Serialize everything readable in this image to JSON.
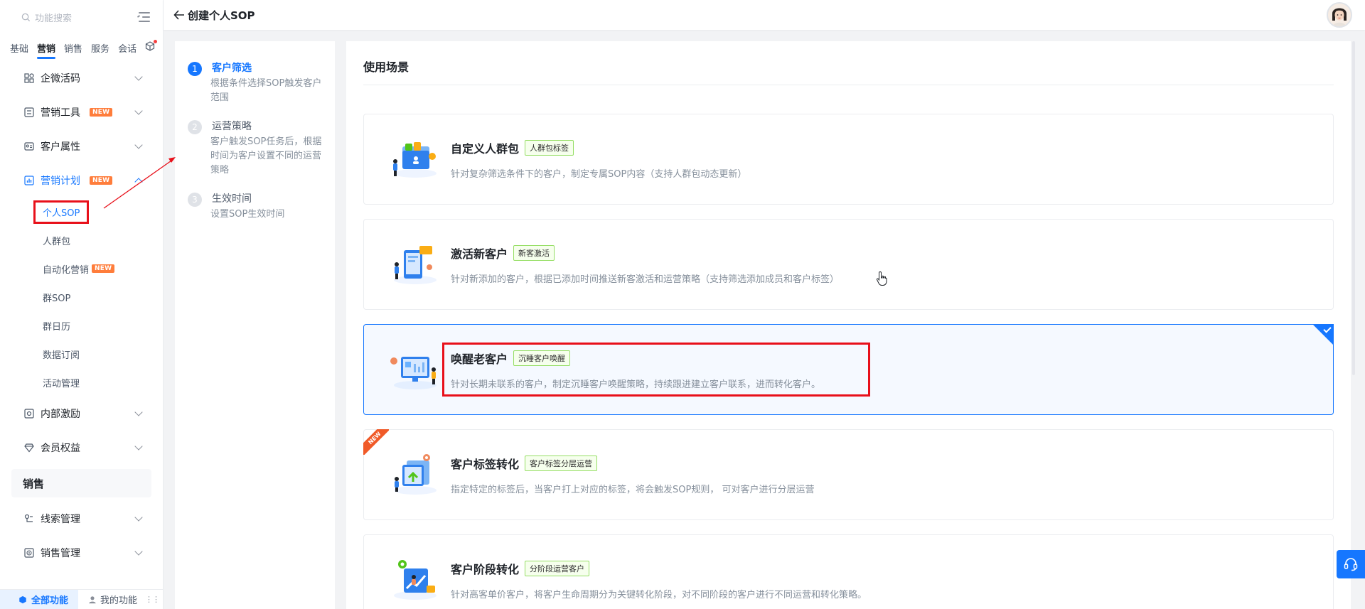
{
  "sidebar": {
    "search_placeholder": "功能搜索",
    "tabs": [
      {
        "label": "基础"
      },
      {
        "label": "营销"
      },
      {
        "label": "销售"
      },
      {
        "label": "服务"
      },
      {
        "label": "会话"
      }
    ],
    "groups": {
      "qw_code": "企微活码",
      "marketing_tools": "营销工具",
      "customer_attr": "客户属性",
      "marketing_plan": "营销计划",
      "internal_incentive": "内部激励",
      "member_benefits": "会员权益",
      "lead_mgmt": "线索管理",
      "sales_mgmt": "销售管理"
    },
    "new_tag": "NEW",
    "sub_items": {
      "personal_sop": "个人SOP",
      "crowd_pack": "人群包",
      "auto_marketing": "自动化营销",
      "group_sop": "群SOP",
      "group_calendar": "群日历",
      "data_subscription": "数据订阅",
      "activity_mgmt": "活动管理"
    },
    "section_sales": "销售",
    "bottom": {
      "all_functions": "全部功能",
      "my_functions": "我的功能"
    }
  },
  "header": {
    "title": "创建个人SOP"
  },
  "steps": [
    {
      "num": "1",
      "title": "客户筛选",
      "desc": "根据条件选择SOP触发客户范围"
    },
    {
      "num": "2",
      "title": "运营策略",
      "desc": "客户触发SOP任务后，根据时间为客户设置不同的运营策略"
    },
    {
      "num": "3",
      "title": "生效时间",
      "desc": "设置SOP生效时间"
    }
  ],
  "main": {
    "title": "使用场景",
    "cards": [
      {
        "title": "自定义人群包",
        "tag": "人群包标签",
        "desc": "针对复杂筛选条件下的客户，制定专属SOP内容（支持人群包动态更新）"
      },
      {
        "title": "激活新客户",
        "tag": "新客激活",
        "desc": "针对新添加的客户，根据已添加时间推送新客激活和运营策略（支持筛选添加成员和客户标签）"
      },
      {
        "title": "唤醒老客户",
        "tag": "沉睡客户唤醒",
        "desc": "针对长期未联系的客户，制定沉睡客户唤醒策略，持续跟进建立客户联系，进而转化客户。"
      },
      {
        "title": "客户标签转化",
        "tag": "客户标签分层运营",
        "desc": "指定特定的标签后，当客户打上对应的标签，将会触发SOP规则， 可对客户进行分层运营"
      },
      {
        "title": "客户阶段转化",
        "tag": "分阶段运营客户",
        "desc": "针对高客单价客户，将客户生命周期分为关键转化阶段，对不同阶段的客户进行不同运营和转化策略。"
      }
    ],
    "new_ribbon": "NEW"
  },
  "colors": {
    "primary": "#1677ff",
    "highlight": "#e8101a",
    "new_tag": "#ff7d3b"
  }
}
